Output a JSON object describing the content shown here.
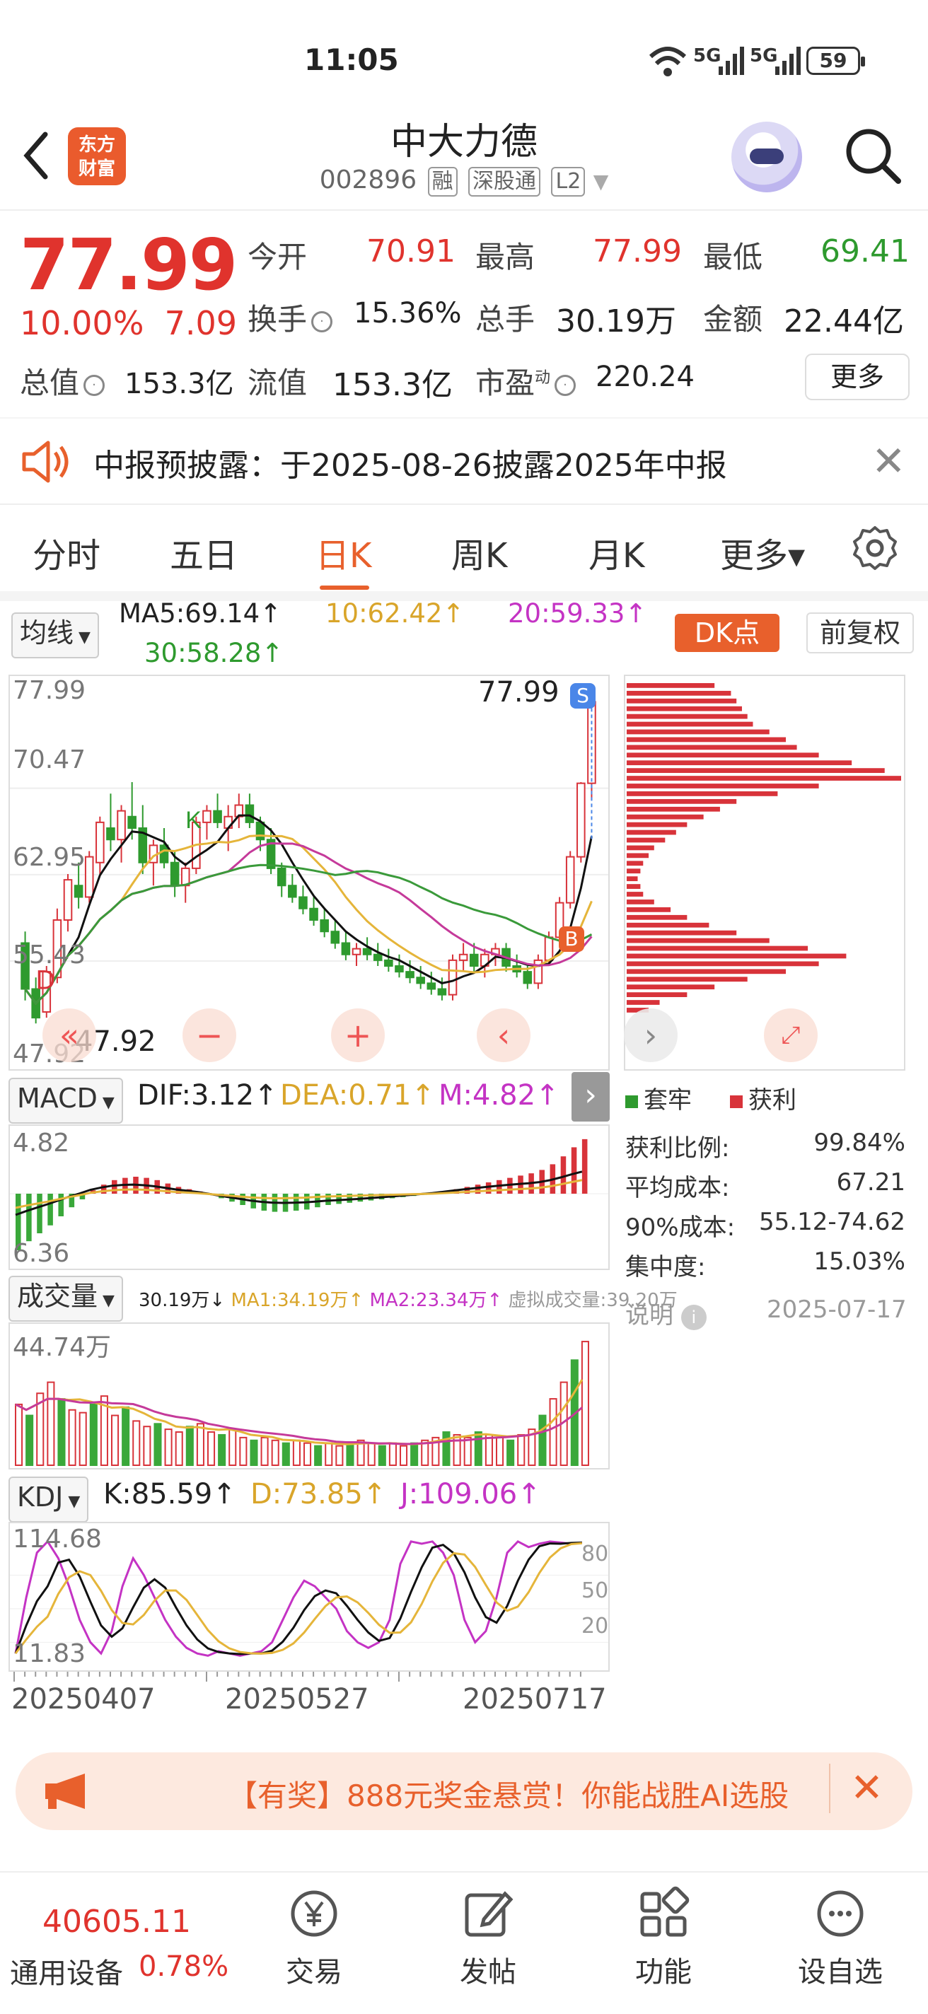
{
  "status_bar": {
    "time": "11:05",
    "signal_1": "7⁶",
    "signal_2": "5G",
    "signal_3": "5G",
    "battery": "59"
  },
  "header": {
    "logo_text": "东方\n财富",
    "title": "中大力德",
    "code": "002896",
    "tags": [
      "融",
      "深股通",
      "L2"
    ]
  },
  "quote": {
    "price": "77.99",
    "change_pct": "10.00%",
    "change_abs": "7.09",
    "open_label": "今开",
    "open": "70.91",
    "high_label": "最高",
    "high": "77.99",
    "low_label": "最低",
    "low": "69.41",
    "turnover_label": "换手",
    "turnover": "15.36%",
    "volume_label": "总手",
    "volume": "30.19万",
    "amount_label": "金额",
    "amount": "22.44亿",
    "mktcap_label": "总值",
    "mktcap": "153.3亿",
    "float_label": "流值",
    "float": "153.3亿",
    "pe_label": "市盈",
    "pe_sup": "动",
    "pe": "220.24",
    "more": "更多"
  },
  "notice": {
    "text": "中报预披露：于2025-08-26披露2025年中报"
  },
  "tabs": [
    "分时",
    "五日",
    "日K",
    "周K",
    "月K",
    "更多▾"
  ],
  "active_tab": "日K",
  "ma_bar": {
    "selector": "均线",
    "ma5": "MA5:69.14↑",
    "ma10": "10:62.42↑",
    "ma20": "20:59.33↑",
    "ma30": "30:58.28↑",
    "dk": "DK点",
    "fq": "前复权"
  },
  "kline": {
    "axis_labels": [
      "77.99",
      "70.47",
      "62.95",
      "55.43",
      "47.92"
    ],
    "max_label": "77.99",
    "min_label": "47.92",
    "markers": {
      "S": "S",
      "K": "K",
      "D": "D",
      "B": "B"
    },
    "colors": {
      "up": "#d8333a",
      "down": "#2e9a2e",
      "ma5": "#111111",
      "ma10": "#e5b53a",
      "ma20": "#c53a9a",
      "ma30": "#3a9a3a"
    },
    "candles": [
      [
        57,
        58,
        52,
        53
      ],
      [
        53,
        54,
        50,
        50.5
      ],
      [
        51,
        55,
        50.5,
        54.5
      ],
      [
        54,
        60,
        53.5,
        59
      ],
      [
        59,
        63,
        58,
        62.5
      ],
      [
        62,
        64,
        60,
        61
      ],
      [
        61,
        65,
        60.5,
        64.5
      ],
      [
        64,
        68,
        63,
        67.5
      ],
      [
        67,
        70,
        65,
        66
      ],
      [
        66,
        69,
        64,
        68.5
      ],
      [
        68,
        71,
        66,
        67
      ],
      [
        67,
        69,
        63,
        64
      ],
      [
        64,
        66,
        62,
        65.5
      ],
      [
        65.5,
        67,
        63.5,
        64
      ],
      [
        64,
        65,
        61,
        62
      ],
      [
        62,
        64,
        60.5,
        63.5
      ],
      [
        63.5,
        68,
        63,
        67.5
      ],
      [
        67.5,
        69,
        66,
        68.5
      ],
      [
        68.5,
        70,
        67,
        67.5
      ],
      [
        67,
        69,
        65,
        68
      ],
      [
        68,
        70,
        67,
        69
      ],
      [
        69,
        70,
        67,
        67.5
      ],
      [
        67.5,
        68,
        65,
        66
      ],
      [
        66,
        67,
        63,
        63.5
      ],
      [
        63.5,
        64,
        61,
        62
      ],
      [
        62,
        63,
        60.5,
        61
      ],
      [
        61,
        62,
        59.5,
        60
      ],
      [
        60,
        61,
        58.5,
        59
      ],
      [
        59,
        60,
        57.5,
        58
      ],
      [
        58,
        59,
        56.5,
        57
      ],
      [
        57,
        58,
        55.5,
        56
      ],
      [
        56,
        57,
        55,
        56.5
      ],
      [
        56.5,
        57.5,
        55.5,
        56
      ],
      [
        56,
        57,
        55,
        55.5
      ],
      [
        55.5,
        56.5,
        54.5,
        55
      ],
      [
        55,
        56,
        54,
        54.5
      ],
      [
        54.5,
        55.5,
        53.5,
        54
      ],
      [
        54,
        55,
        53,
        53.5
      ],
      [
        53.5,
        54.5,
        52.5,
        53
      ],
      [
        53,
        54,
        52,
        52.5
      ],
      [
        52.5,
        56,
        52,
        55.5
      ],
      [
        55.5,
        57,
        54.5,
        56
      ],
      [
        56,
        57,
        54.5,
        55
      ],
      [
        55,
        56.5,
        54,
        56
      ],
      [
        56,
        57,
        55,
        56.5
      ],
      [
        56.5,
        57,
        54.5,
        55
      ],
      [
        55,
        56,
        54,
        54.5
      ],
      [
        54.5,
        55,
        53,
        53.5
      ],
      [
        53.5,
        56,
        53,
        55.5
      ],
      [
        55.5,
        58,
        55,
        57.5
      ],
      [
        57.5,
        61,
        57,
        60.5
      ],
      [
        60.5,
        65,
        60,
        64.5
      ],
      [
        64.5,
        71,
        64,
        70.9
      ],
      [
        70.9,
        77.99,
        69.41,
        77.99
      ]
    ]
  },
  "chip": {
    "legend_trapped": "套牢",
    "legend_profit": "获利",
    "rows": [
      {
        "label": "获利比例:",
        "value": "99.84%"
      },
      {
        "label": "平均成本:",
        "value": "67.21"
      },
      {
        "label": "90%成本:",
        "value": "55.12-74.62"
      },
      {
        "label": "集中度:",
        "value": "15.03%"
      }
    ],
    "note": "说明",
    "date": "2025-07-17",
    "bars": [
      0.32,
      0.38,
      0.4,
      0.42,
      0.44,
      0.46,
      0.52,
      0.58,
      0.62,
      0.7,
      0.82,
      0.94,
      1.0,
      0.7,
      0.55,
      0.4,
      0.34,
      0.28,
      0.22,
      0.18,
      0.14,
      0.1,
      0.08,
      0.06,
      0.05,
      0.04,
      0.05,
      0.06,
      0.1,
      0.16,
      0.22,
      0.3,
      0.4,
      0.52,
      0.66,
      0.8,
      0.7,
      0.58,
      0.44,
      0.32,
      0.22,
      0.12,
      0.08
    ]
  },
  "macd": {
    "selector": "MACD",
    "dif": "DIF:3.12↑",
    "dea": "DEA:0.71↑",
    "m": "M:4.82↑",
    "top": "4.82",
    "bottom": "6.36"
  },
  "volume": {
    "selector": "成交量",
    "vol": "30.19万↓",
    "ma1": "MA1:34.19万↑",
    "ma2": "MA2:23.34万↑",
    "virtual": "虚拟成交量:39.20万",
    "top": "44.74万"
  },
  "kdj": {
    "selector": "KDJ",
    "k": "K:85.59↑",
    "d": "D:73.85↑",
    "j": "J:109.06↑",
    "top": "114.68",
    "bottom": "11.83",
    "levels": [
      "80",
      "50",
      "20"
    ]
  },
  "dates": [
    "20250407",
    "20250527",
    "20250717"
  ],
  "ad": {
    "text": "【有奖】888元奖金悬赏！你能战胜AI选股"
  },
  "bottom_nav": {
    "index_value": "40605.11",
    "index_name": "通用设备",
    "index_pct": "0.78%",
    "items": [
      "交易",
      "发帖",
      "功能",
      "设自选"
    ]
  }
}
